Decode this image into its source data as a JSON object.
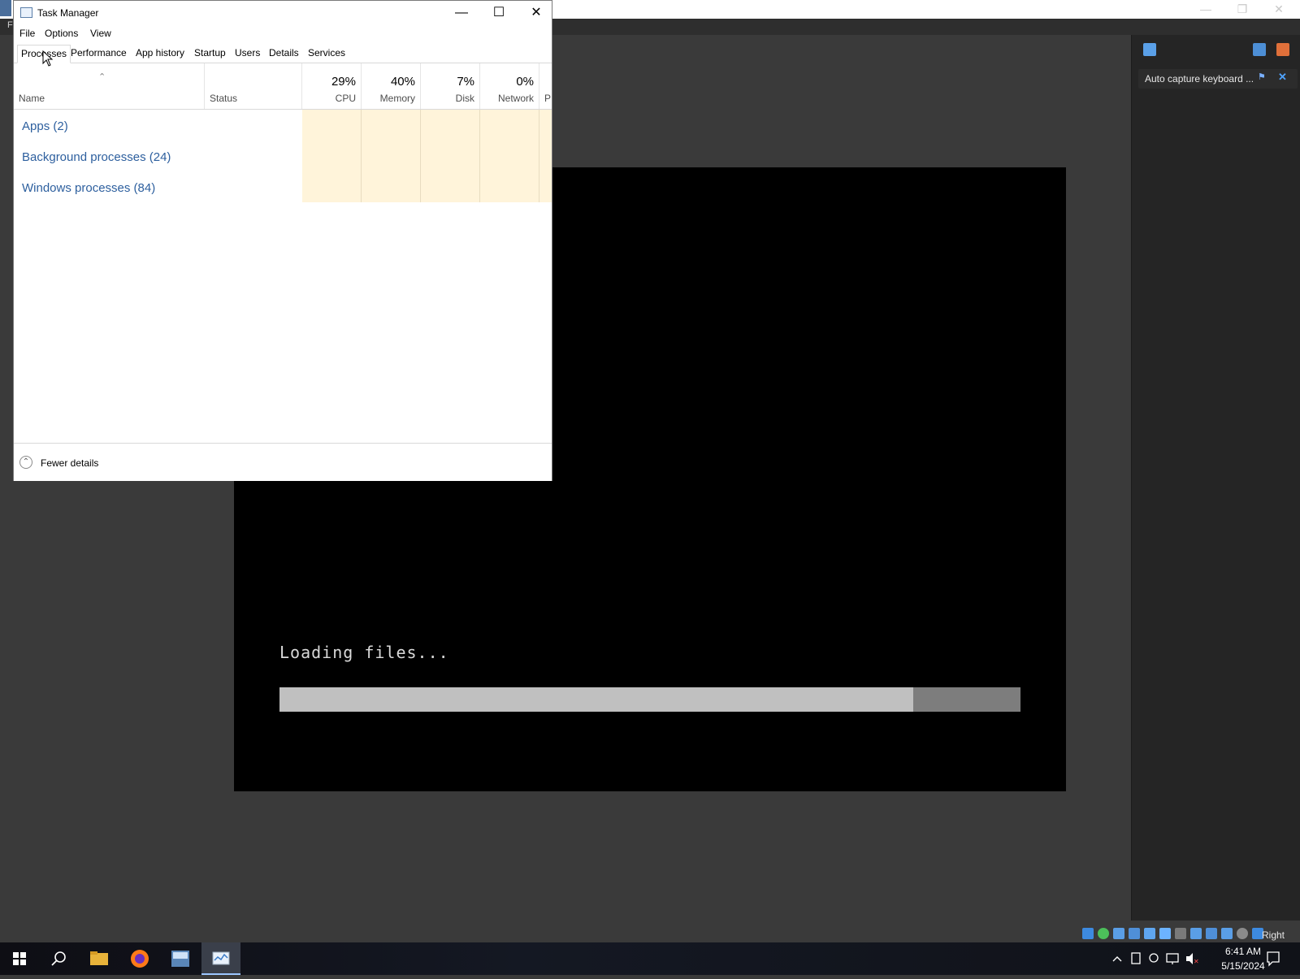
{
  "task_manager": {
    "title": "Task Manager",
    "window_controls": {
      "minimize": "—",
      "maximize": "☐",
      "close": "✕"
    },
    "menu": [
      "File",
      "Options",
      "View"
    ],
    "tabs": [
      "Processes",
      "Performance",
      "App history",
      "Startup",
      "Users",
      "Details",
      "Services"
    ],
    "selected_tab": "Processes",
    "columns": {
      "name": "Name",
      "status": "Status",
      "cpu": {
        "pct": "29%",
        "label": "CPU"
      },
      "memory": {
        "pct": "40%",
        "label": "Memory"
      },
      "disk": {
        "pct": "7%",
        "label": "Disk"
      },
      "network": {
        "pct": "0%",
        "label": "Network"
      },
      "power_partial": "P"
    },
    "groups": [
      "Apps (2)",
      "Background processes (24)",
      "Windows processes (84)"
    ],
    "footer": {
      "label": "Fewer details"
    }
  },
  "host": {
    "menu_first": "F",
    "side_panel": {
      "chip_label": "Auto capture keyboard ..."
    },
    "status_right_text": "Right Ctrl"
  },
  "guest": {
    "loading_text": "Loading files...",
    "progress_fraction": 0.855
  },
  "taskbar": {
    "time": "6:41 AM",
    "date": "5/15/2024"
  }
}
